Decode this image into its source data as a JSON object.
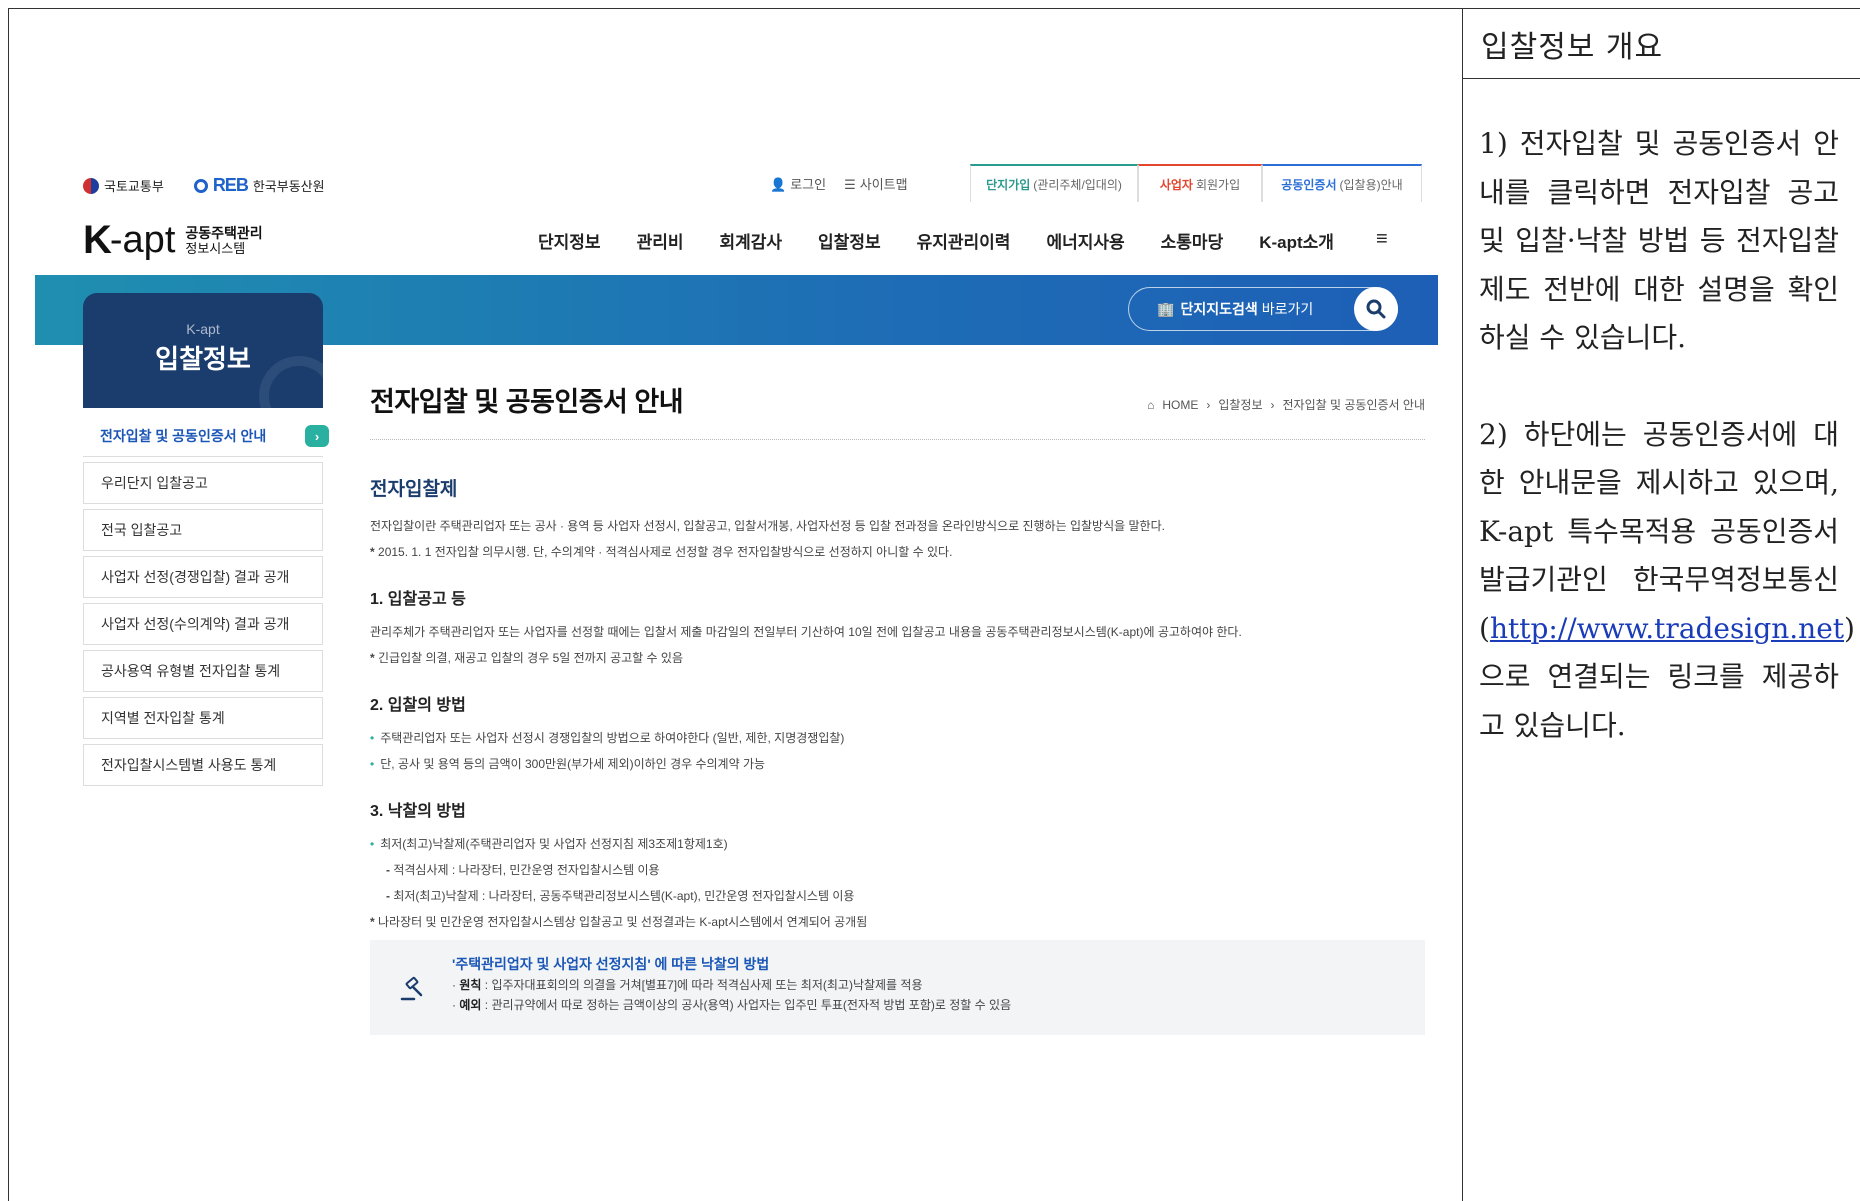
{
  "right_panel": {
    "title": "입찰정보 개요",
    "para1": "1) 전자입찰 및 공동인증서 안내를 클릭하면 전자입찰 공고 및 입찰·낙찰 방법 등 전자입찰제도 전반에 대한 설명을 확인하실 수 있습니다.",
    "para2_pre": "2) 하단에는 공동인증서에 대한 안내문을 제시하고 있으며, K-apt 특수목적용 공동인증서 발급기관인 한국무역정보통신 (",
    "para2_link": "http://www.tradesign.net",
    "para2_post": ") 으로 연결되는 링크를 제공하고 있습니다."
  },
  "site": {
    "gov_logo1": "국토교통부",
    "gov_logo2_brand": "REB",
    "gov_logo2_text": "한국부동산원",
    "util": {
      "login": "로그인",
      "sitemap": "사이트맵"
    },
    "top_tabs": [
      {
        "strong": "단지가입",
        "sub": "(관리주체/입대의)"
      },
      {
        "strong": "사업자",
        "sub": "회원가입"
      },
      {
        "strong": "공동인증서",
        "sub": "(입찰용)안내"
      }
    ],
    "logo": {
      "k": "K",
      "apt": "-apt",
      "sub1": "공동주택관리",
      "sub2": "정보시스템"
    },
    "gnb": [
      "단지정보",
      "관리비",
      "회계감사",
      "입찰정보",
      "유지관리이력",
      "에너지사용",
      "소통마당",
      "K-apt소개"
    ],
    "map_search": {
      "strong": "단지지도검색",
      "sub": "바로가기"
    },
    "lnb_head": {
      "small": "K-apt",
      "big": "입찰정보"
    },
    "lnb": [
      "전자입찰 및 공동인증서 안내",
      "우리단지 입찰공고",
      "전국 입찰공고",
      "사업자 선정(경쟁입찰) 결과 공개",
      "사업자 선정(수의계약) 결과 공개",
      "공사용역 유형별 전자입찰 통계",
      "지역별 전자입찰 통계",
      "전자입찰시스템별 사용도 통계"
    ],
    "page_title": "전자입찰 및 공동인증서 안내",
    "breadcrumb": [
      "HOME",
      "입찰정보",
      "전자입찰 및 공동인증서 안내"
    ],
    "section_title": "전자입찰제",
    "intro1": "전자입찰이란 주택관리업자 또는 공사 · 용역 등 사업자 선정시, 입찰공고, 입찰서개봉, 사업자선정 등 입찰 전과정을 온라인방식으로 진행하는 입찰방식을 말한다.",
    "intro2": "2015. 1. 1 전자입찰 의무시행. 단, 수의계약 · 적격심사제로 선정할 경우 전자입찰방식으로 선정하지 아니할 수 있다.",
    "h1": "1. 입찰공고 등",
    "s1_txt": "관리주체가 주택관리업자 또는 사업자를 선정할 때에는 입찰서 제출 마감일의 전일부터 기산하여 10일 전에 입찰공고 내용을 공동주택관리정보시스템(K-apt)에 공고하여야 한다.",
    "s1_note": "긴급입찰 의결, 재공고 입찰의 경우 5일 전까지 공고할 수 있음",
    "h2": "2. 입찰의 방법",
    "s2_b1": "주택관리업자 또는 사업자 선정시 경쟁입찰의 방법으로 하여야한다 (일반, 제한, 지명경쟁입찰)",
    "s2_b2": "단, 공사 및 용역 등의 금액이 300만원(부가세 제외)이하인 경우 수의계약 가능",
    "h3": "3. 낙찰의 방법",
    "s3_b1": "최저(최고)낙찰제(주택관리업자 및 사업자 선정지침 제3조제1항제1호)",
    "s3_d1": "적격심사제 : 나라장터, 민간운영 전자입찰시스템 이용",
    "s3_d2": "최저(최고)낙찰제 : 나라장터, 공동주택관리정보시스템(K-apt), 민간운영 전자입찰시스템 이용",
    "s3_note": "나라장터 및 민간운영 전자입찰시스템상 입찰공고 및 선정결과는 K-apt시스템에서 연계되어 공개됨",
    "box": {
      "title": "'주택관리업자 및 사업자 선정지침' 에 따른 낙찰의 방법",
      "l1_label": "원칙",
      "l1_text": " : 입주자대표회의의 의결을 거쳐[별표7]에 따라 적격심사제 또는 최저(최고)낙찰제를 적용",
      "l2_label": "예외",
      "l2_text": " : 관리규약에서 따로 정하는 금액이상의 공사(용역) 사업자는 입주민 투표(전자적 방법 포함)로 정할 수 있음"
    }
  }
}
